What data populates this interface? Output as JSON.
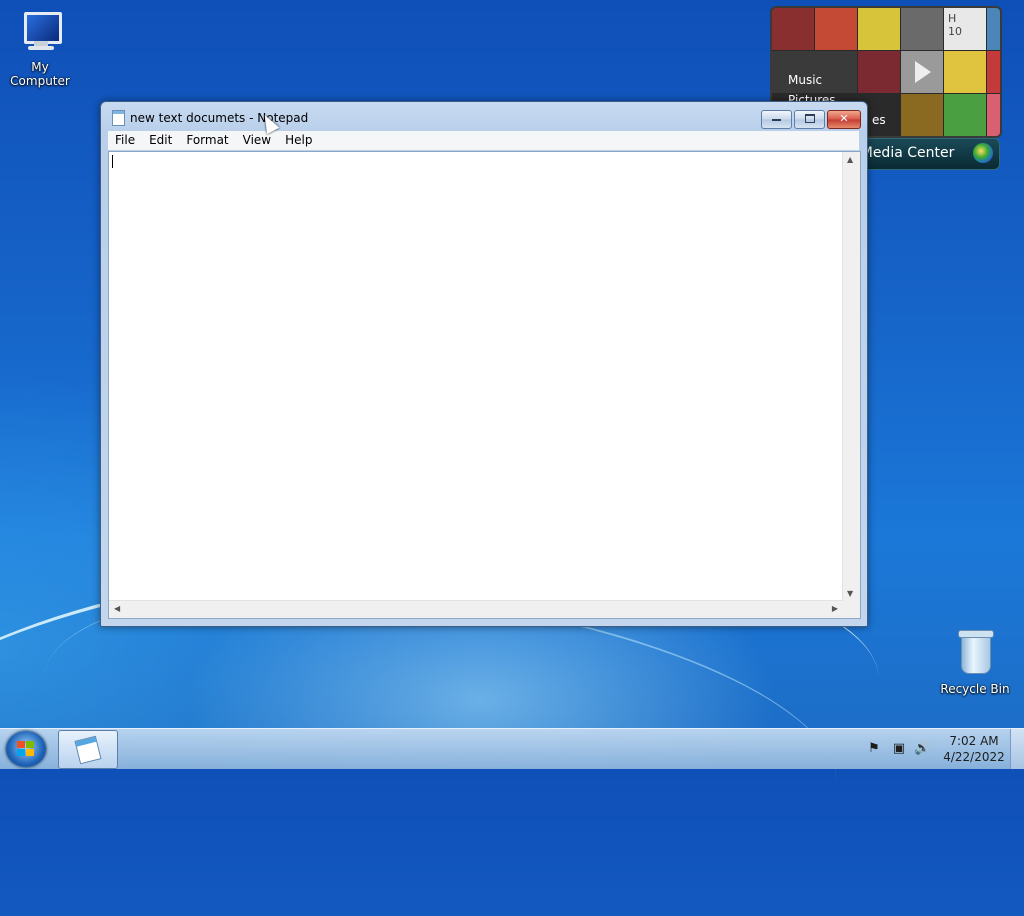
{
  "desktop": {
    "icons": [
      {
        "label": "My Computer",
        "icon": "computer-icon"
      },
      {
        "label": "Recycle Bin",
        "icon": "recycle-bin-icon"
      }
    ]
  },
  "media_center": {
    "menu": [
      "Music",
      "Pictures",
      "es"
    ],
    "title": "s Media Center",
    "tile_text": [
      "H",
      "10"
    ]
  },
  "notepad": {
    "title": "new text documets - Notepad",
    "menu": [
      "File",
      "Edit",
      "Format",
      "View",
      "Help"
    ],
    "content": "",
    "buttons": {
      "minimize": "minimize-icon",
      "maximize": "maximize-icon",
      "close": "close-icon"
    }
  },
  "taskbar": {
    "time": "7:02 AM",
    "date": "4/22/2022",
    "tray_icons": [
      "action-center-flag-icon",
      "network-icon",
      "volume-icon"
    ]
  }
}
